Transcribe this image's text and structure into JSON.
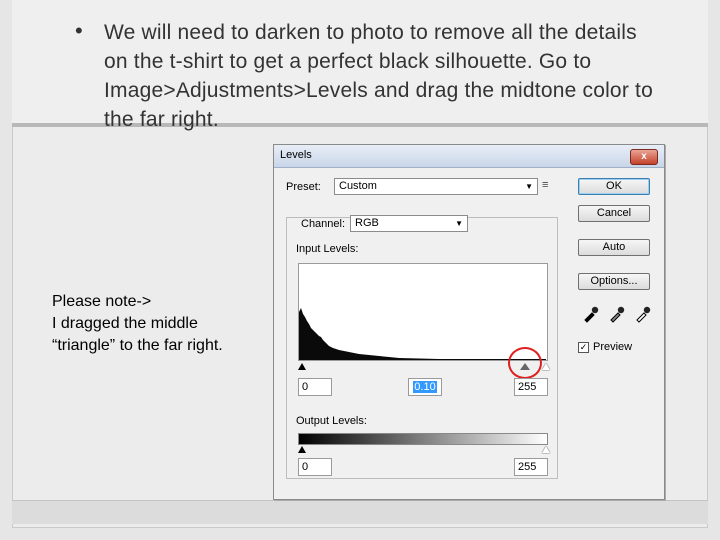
{
  "slide": {
    "bullet": "•",
    "title": "We will need to darken to photo to remove all the details on the t-shirt to get a perfect black silhouette. Go to Image>Adjustments>Levels and drag the midtone color to the far right.",
    "note": "Please note->\nI dragged the middle\n“triangle” to the far right."
  },
  "dialog": {
    "title": "Levels",
    "close_label": "x",
    "preset_label": "Preset:",
    "preset_value": "Custom",
    "preset_menu_glyph": "≡",
    "channel_label": "Channel:",
    "channel_value": "RGB",
    "input_levels_label": "Input Levels:",
    "input_values": {
      "black": "0",
      "mid": "0.10",
      "white": "255"
    },
    "output_levels_label": "Output Levels:",
    "output_values": {
      "black": "0",
      "white": "255"
    },
    "buttons": {
      "ok": "OK",
      "cancel": "Cancel",
      "auto": "Auto",
      "options": "Options..."
    },
    "preview_label": "Preview",
    "preview_checked": true,
    "icons": [
      "black-eyedropper-icon",
      "gray-eyedropper-icon",
      "white-eyedropper-icon"
    ],
    "highlight_color": "#e02020"
  }
}
